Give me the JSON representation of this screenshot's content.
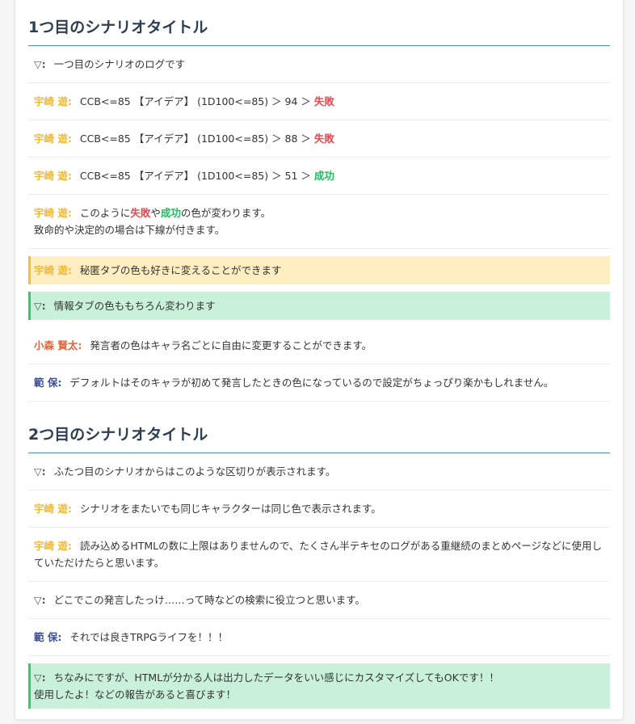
{
  "colors": {
    "uzaki": "#f5b82e",
    "komori": "#e8643c",
    "han": "#3a4fa0",
    "system": "#555555",
    "fail": "#f0474f",
    "success": "#27b85f"
  },
  "scenarios": [
    {
      "title": "1つ目のシナリオタイトル",
      "messages": [
        {
          "type": "normal",
          "name": "▽:",
          "who": "system",
          "parts": [
            {
              "t": "一つ目のシナリオのログです"
            }
          ]
        },
        {
          "type": "normal",
          "name": "宇崎 遊:",
          "who": "uzaki",
          "parts": [
            {
              "t": "CCB<=85 【アイデア】 (1D100<=85) ＞ 94 ＞ "
            },
            {
              "t": "失敗",
              "c": "fail"
            }
          ]
        },
        {
          "type": "normal",
          "name": "宇崎 遊:",
          "who": "uzaki",
          "parts": [
            {
              "t": "CCB<=85 【アイデア】 (1D100<=85) ＞ 88 ＞ "
            },
            {
              "t": "失敗",
              "c": "fail"
            }
          ]
        },
        {
          "type": "normal",
          "name": "宇崎 遊:",
          "who": "uzaki",
          "parts": [
            {
              "t": "CCB<=85 【アイデア】 (1D100<=85) ＞ 51 ＞ "
            },
            {
              "t": "成功",
              "c": "success"
            }
          ]
        },
        {
          "type": "normal",
          "name": "宇崎 遊:",
          "who": "uzaki",
          "parts": [
            {
              "t": "このように"
            },
            {
              "t": "失敗",
              "c": "fail"
            },
            {
              "t": "や"
            },
            {
              "t": "成功",
              "c": "success"
            },
            {
              "t": "の色が変わります。"
            },
            {
              "br": true
            },
            {
              "t": "致命的や決定的の場合は下線が付きます。"
            }
          ]
        },
        {
          "type": "secret",
          "name": "宇崎 遊:",
          "who": "uzaki",
          "parts": [
            {
              "t": "秘匿タブの色も好きに変えることができます"
            }
          ]
        },
        {
          "type": "info",
          "name": "▽:",
          "who": "system",
          "parts": [
            {
              "t": "情報タブの色ももちろん変わります"
            }
          ]
        },
        {
          "type": "normal",
          "name": "小森 賢太:",
          "who": "komori",
          "parts": [
            {
              "t": "発言者の色はキャラ名ごとに自由に変更することができます。"
            }
          ]
        },
        {
          "type": "normal",
          "name": "範 保:",
          "who": "han",
          "parts": [
            {
              "t": "デフォルトはそのキャラが初めて発言したときの色になっているので設定がちょっぴり楽かもしれません。"
            }
          ]
        }
      ]
    },
    {
      "title": "2つ目のシナリオタイトル",
      "messages": [
        {
          "type": "normal",
          "name": "▽:",
          "who": "system",
          "parts": [
            {
              "t": "ふたつ目のシナリオからはこのような区切りが表示されます。"
            }
          ]
        },
        {
          "type": "normal",
          "name": "宇崎 遊:",
          "who": "uzaki",
          "parts": [
            {
              "t": "シナリオをまたいでも同じキャラクターは同じ色で表示されます。"
            }
          ]
        },
        {
          "type": "normal",
          "name": "宇崎 遊:",
          "who": "uzaki",
          "parts": [
            {
              "t": "読み込めるHTMLの数に上限はありませんので、たくさん半テキセのログがある重継続のまとめページなどに使用していただけたらと思います。"
            }
          ]
        },
        {
          "type": "normal",
          "name": "▽:",
          "who": "system",
          "parts": [
            {
              "t": "どこでこの発言したっけ……って時などの検索に役立つと思います。"
            }
          ]
        },
        {
          "type": "normal",
          "name": "範 保:",
          "who": "han",
          "parts": [
            {
              "t": "それでは良きTRPGライフを！！！"
            }
          ]
        },
        {
          "type": "info",
          "name": "▽:",
          "who": "system",
          "parts": [
            {
              "t": "ちなみにですが、HTMLが分かる人は出力したデータをいい感じにカスタマイズしてもOKです！！"
            },
            {
              "br": true
            },
            {
              "t": "使用したよ！などの報告があると喜びます！"
            }
          ]
        }
      ]
    }
  ]
}
